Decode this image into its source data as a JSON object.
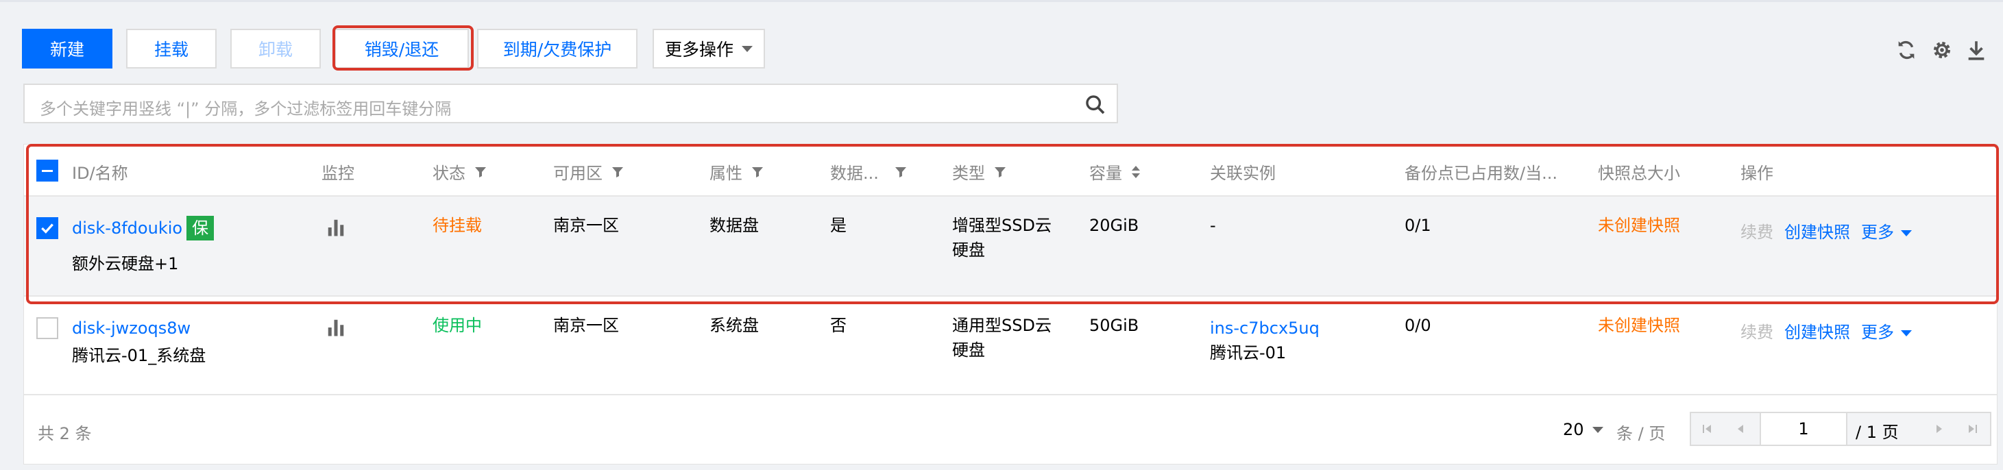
{
  "toolbar": {
    "new_label": "新建",
    "mount_label": "挂载",
    "unmount_label": "卸载",
    "destroy_label": "销毁/退还",
    "expiry_label": "到期/欠费保护",
    "more_label": "更多操作"
  },
  "search": {
    "placeholder": "多个关键字用竖线 “|” 分隔，多个过滤标签用回车键分隔"
  },
  "table": {
    "headers": {
      "id_name": "ID/名称",
      "monitor": "监控",
      "status": "状态",
      "zone": "可用区",
      "attribute": "属性",
      "data": "数据...",
      "type": "类型",
      "capacity": "容量",
      "instance": "关联实例",
      "backup": "备份点已占用数/当...",
      "snapshot_size": "快照总大小",
      "actions": "操作"
    },
    "rows": [
      {
        "id": "disk-8fdoukio",
        "badge": "保",
        "name": "额外云硬盘+1",
        "status": "待挂载",
        "zone": "南京一区",
        "attribute": "数据盘",
        "data": "是",
        "type_line1": "增强型SSD云",
        "type_line2": "硬盘",
        "capacity": "20GiB",
        "instance": "-",
        "instance_name": "",
        "backup": "0/1",
        "snapshot": "未创建快照",
        "renew": "续费",
        "create_snapshot": "创建快照",
        "more": "更多"
      },
      {
        "id": "disk-jwzoqs8w",
        "badge": "",
        "name": "腾讯云-01_系统盘",
        "status": "使用中",
        "zone": "南京一区",
        "attribute": "系统盘",
        "data": "否",
        "type_line1": "通用型SSD云",
        "type_line2": "硬盘",
        "capacity": "50GiB",
        "instance": "ins-c7bcx5uq",
        "instance_name": "腾讯云-01",
        "backup": "0/0",
        "snapshot": "未创建快照",
        "renew": "续费",
        "create_snapshot": "创建快照",
        "more": "更多"
      }
    ]
  },
  "footer": {
    "total": "共 2 条",
    "page_size": "20",
    "per_page": "条 / 页",
    "current_page": "1",
    "total_pages": "/ 1 页"
  },
  "colors": {
    "primary": "#006eff",
    "warning": "#ff7200",
    "success": "#0abf5b",
    "highlight": "#d9372a",
    "badge": "#22a94a"
  }
}
